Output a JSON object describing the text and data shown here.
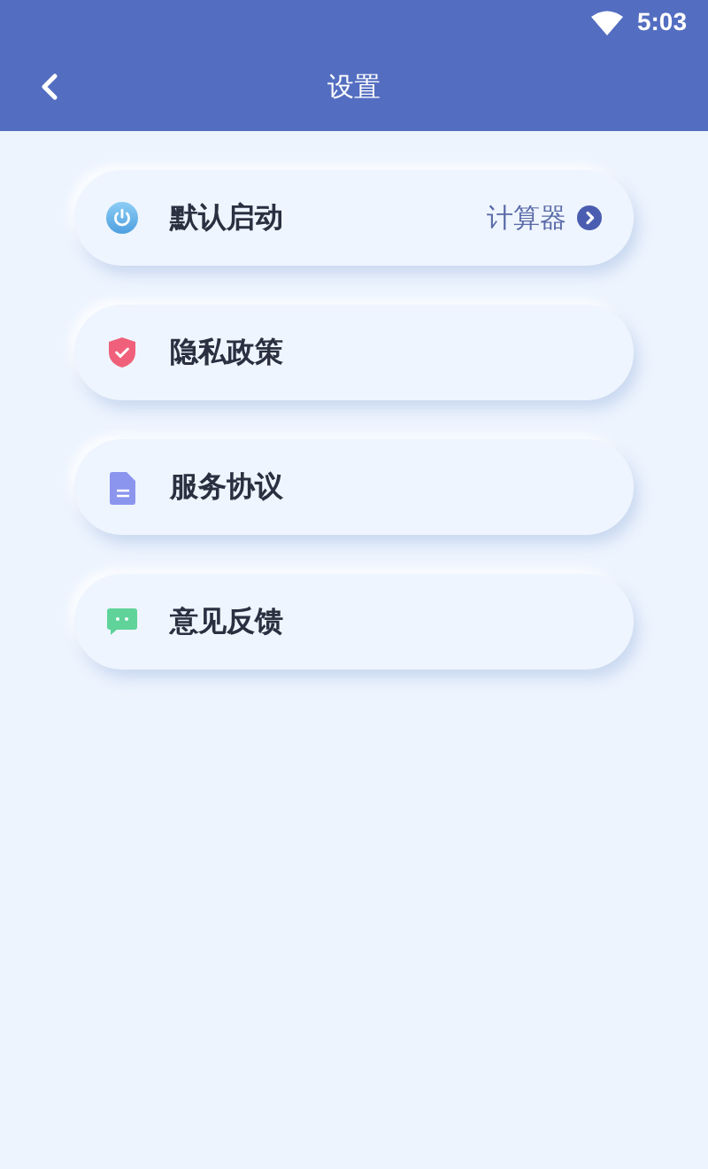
{
  "status_bar": {
    "time": "5:03"
  },
  "header": {
    "title": "设置"
  },
  "items": [
    {
      "kind": "power",
      "label": "默认启动",
      "value": "计算器"
    },
    {
      "kind": "shield",
      "label": "隐私政策"
    },
    {
      "kind": "document",
      "label": "服务协议"
    },
    {
      "kind": "chat",
      "label": "意见反馈"
    }
  ]
}
